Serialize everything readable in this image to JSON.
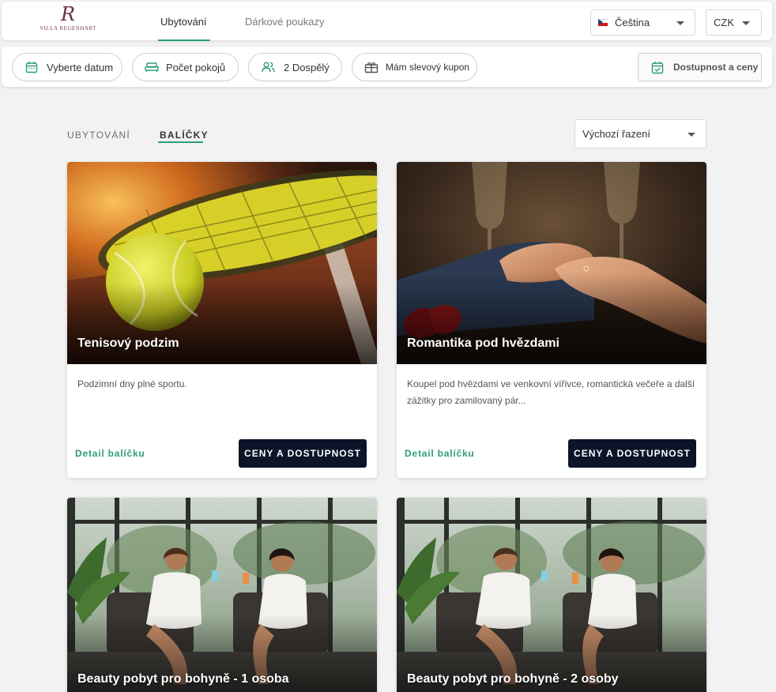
{
  "header": {
    "logo": {
      "monogram": "R",
      "name": "VILLA REGENHART"
    },
    "nav": [
      {
        "label": "Ubytování",
        "active": true
      },
      {
        "label": "Dárkové poukazy",
        "active": false
      }
    ],
    "language": {
      "value": "Čeština",
      "flag_icon": "czech-flag-icon"
    },
    "currency": {
      "value": "CZK"
    }
  },
  "filters": {
    "date": {
      "label": "Vyberte datum",
      "icon": "calendar-icon"
    },
    "rooms": {
      "label": "Počet pokojů",
      "icon": "bed-icon"
    },
    "guests": {
      "label": "2 Dospělý",
      "icon": "people-icon"
    },
    "coupon": {
      "label": "Mám slevový kupon",
      "icon": "coupon-icon"
    },
    "availability": {
      "label": "Dostupnost a ceny",
      "icon": "calendar-check-icon"
    }
  },
  "section": {
    "tabs": [
      {
        "label": "UBYTOVÁNÍ",
        "active": false
      },
      {
        "label": "BALÍČKY",
        "active": true
      }
    ],
    "sort": {
      "value": "Výchozí řazení"
    }
  },
  "packages": [
    {
      "title": "Tenisový podzim",
      "description": "Podzimní dny plné sportu.",
      "detail_label": "Detail balíčku",
      "cta_label": "CENY A DOSTUPNOST"
    },
    {
      "title": "Romantika pod hvězdami",
      "description": "Koupel pod hvězdami ve venkovní vířivce, romantická večeře a další zážitky pro zamilovaný pár...",
      "detail_label": "Detail balíčku",
      "cta_label": "CENY A DOSTUPNOST"
    },
    {
      "title": "Beauty pobyt pro bohyně - 1 osoba"
    },
    {
      "title": "Beauty pobyt pro bohyně - 2 osoby"
    }
  ],
  "colors": {
    "accent": "#2e9e74",
    "cta": "#0b1428",
    "background": "#f2f2f2"
  }
}
